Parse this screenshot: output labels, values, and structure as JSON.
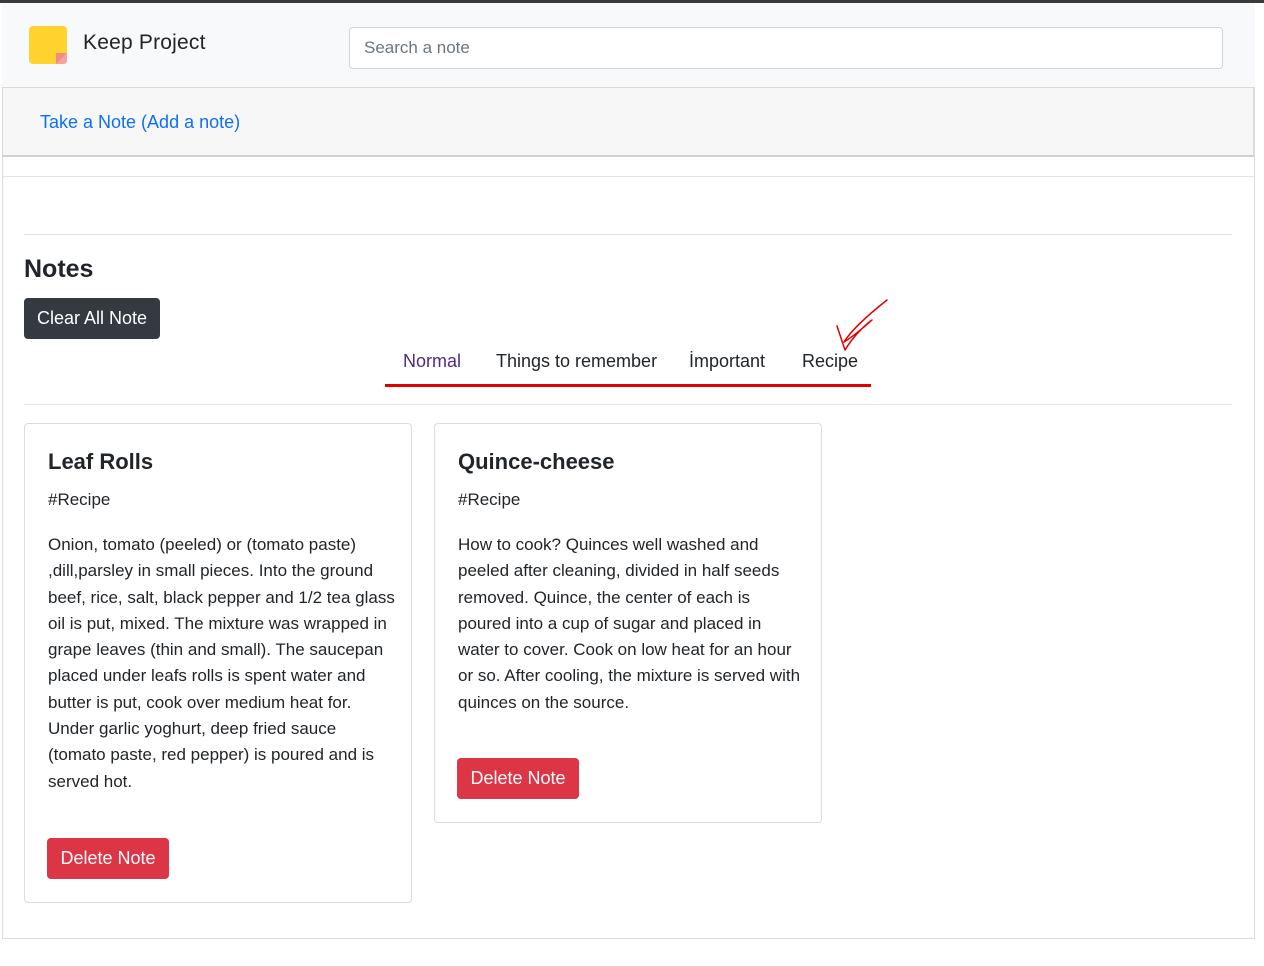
{
  "app": {
    "brand": "Keep Project",
    "logo_icon": "sticky-note-icon",
    "search_placeholder": "Search a note"
  },
  "take_note": {
    "label": "Take a Note (Add a note)"
  },
  "notes_section": {
    "title": "Notes",
    "clear_label": "Clear All Note"
  },
  "tabs": [
    {
      "label": "Normal",
      "active": true
    },
    {
      "label": "Things to remember",
      "active": false
    },
    {
      "label": "İmportant",
      "active": false
    },
    {
      "label": "Recipe",
      "active": false
    }
  ],
  "annotation": {
    "icon": "red-checkmark-icon",
    "color": "#e00000"
  },
  "notes": [
    {
      "title": "Leaf Rolls",
      "tag": "#Recipe",
      "text": "Onion, tomato (peeled) or (tomato paste) ,dill,parsley in small pieces. Into the ground beef, rice, salt, black pepper and 1/2 tea glass oil is put, mixed. The mixture was wrapped in grape leaves (thin and small). The saucepan placed under leafs rolls is spent water and butter is put, cook over medium heat for. Under garlic yoghurt, deep fried sauce (tomato paste, red pepper) is poured and is served hot.",
      "delete_label": "Delete Note"
    },
    {
      "title": "Quince-cheese",
      "tag": "#Recipe",
      "text": "How to cook? Quinces well washed and peeled after cleaning, divided in half seeds removed. Quince, the center of each is poured into a cup of sugar and placed in water to cover. Cook on low heat for an hour or so. After cooling, the mixture is served with quinces on the source.",
      "delete_label": "Delete Note"
    }
  ],
  "colors": {
    "link": "#0d6efd",
    "dark_button": "#343a40",
    "danger_button": "#dc3545",
    "active_tab": "#4f2a8a",
    "tab_underline": "#e00000",
    "logo": "#ffd22e"
  }
}
